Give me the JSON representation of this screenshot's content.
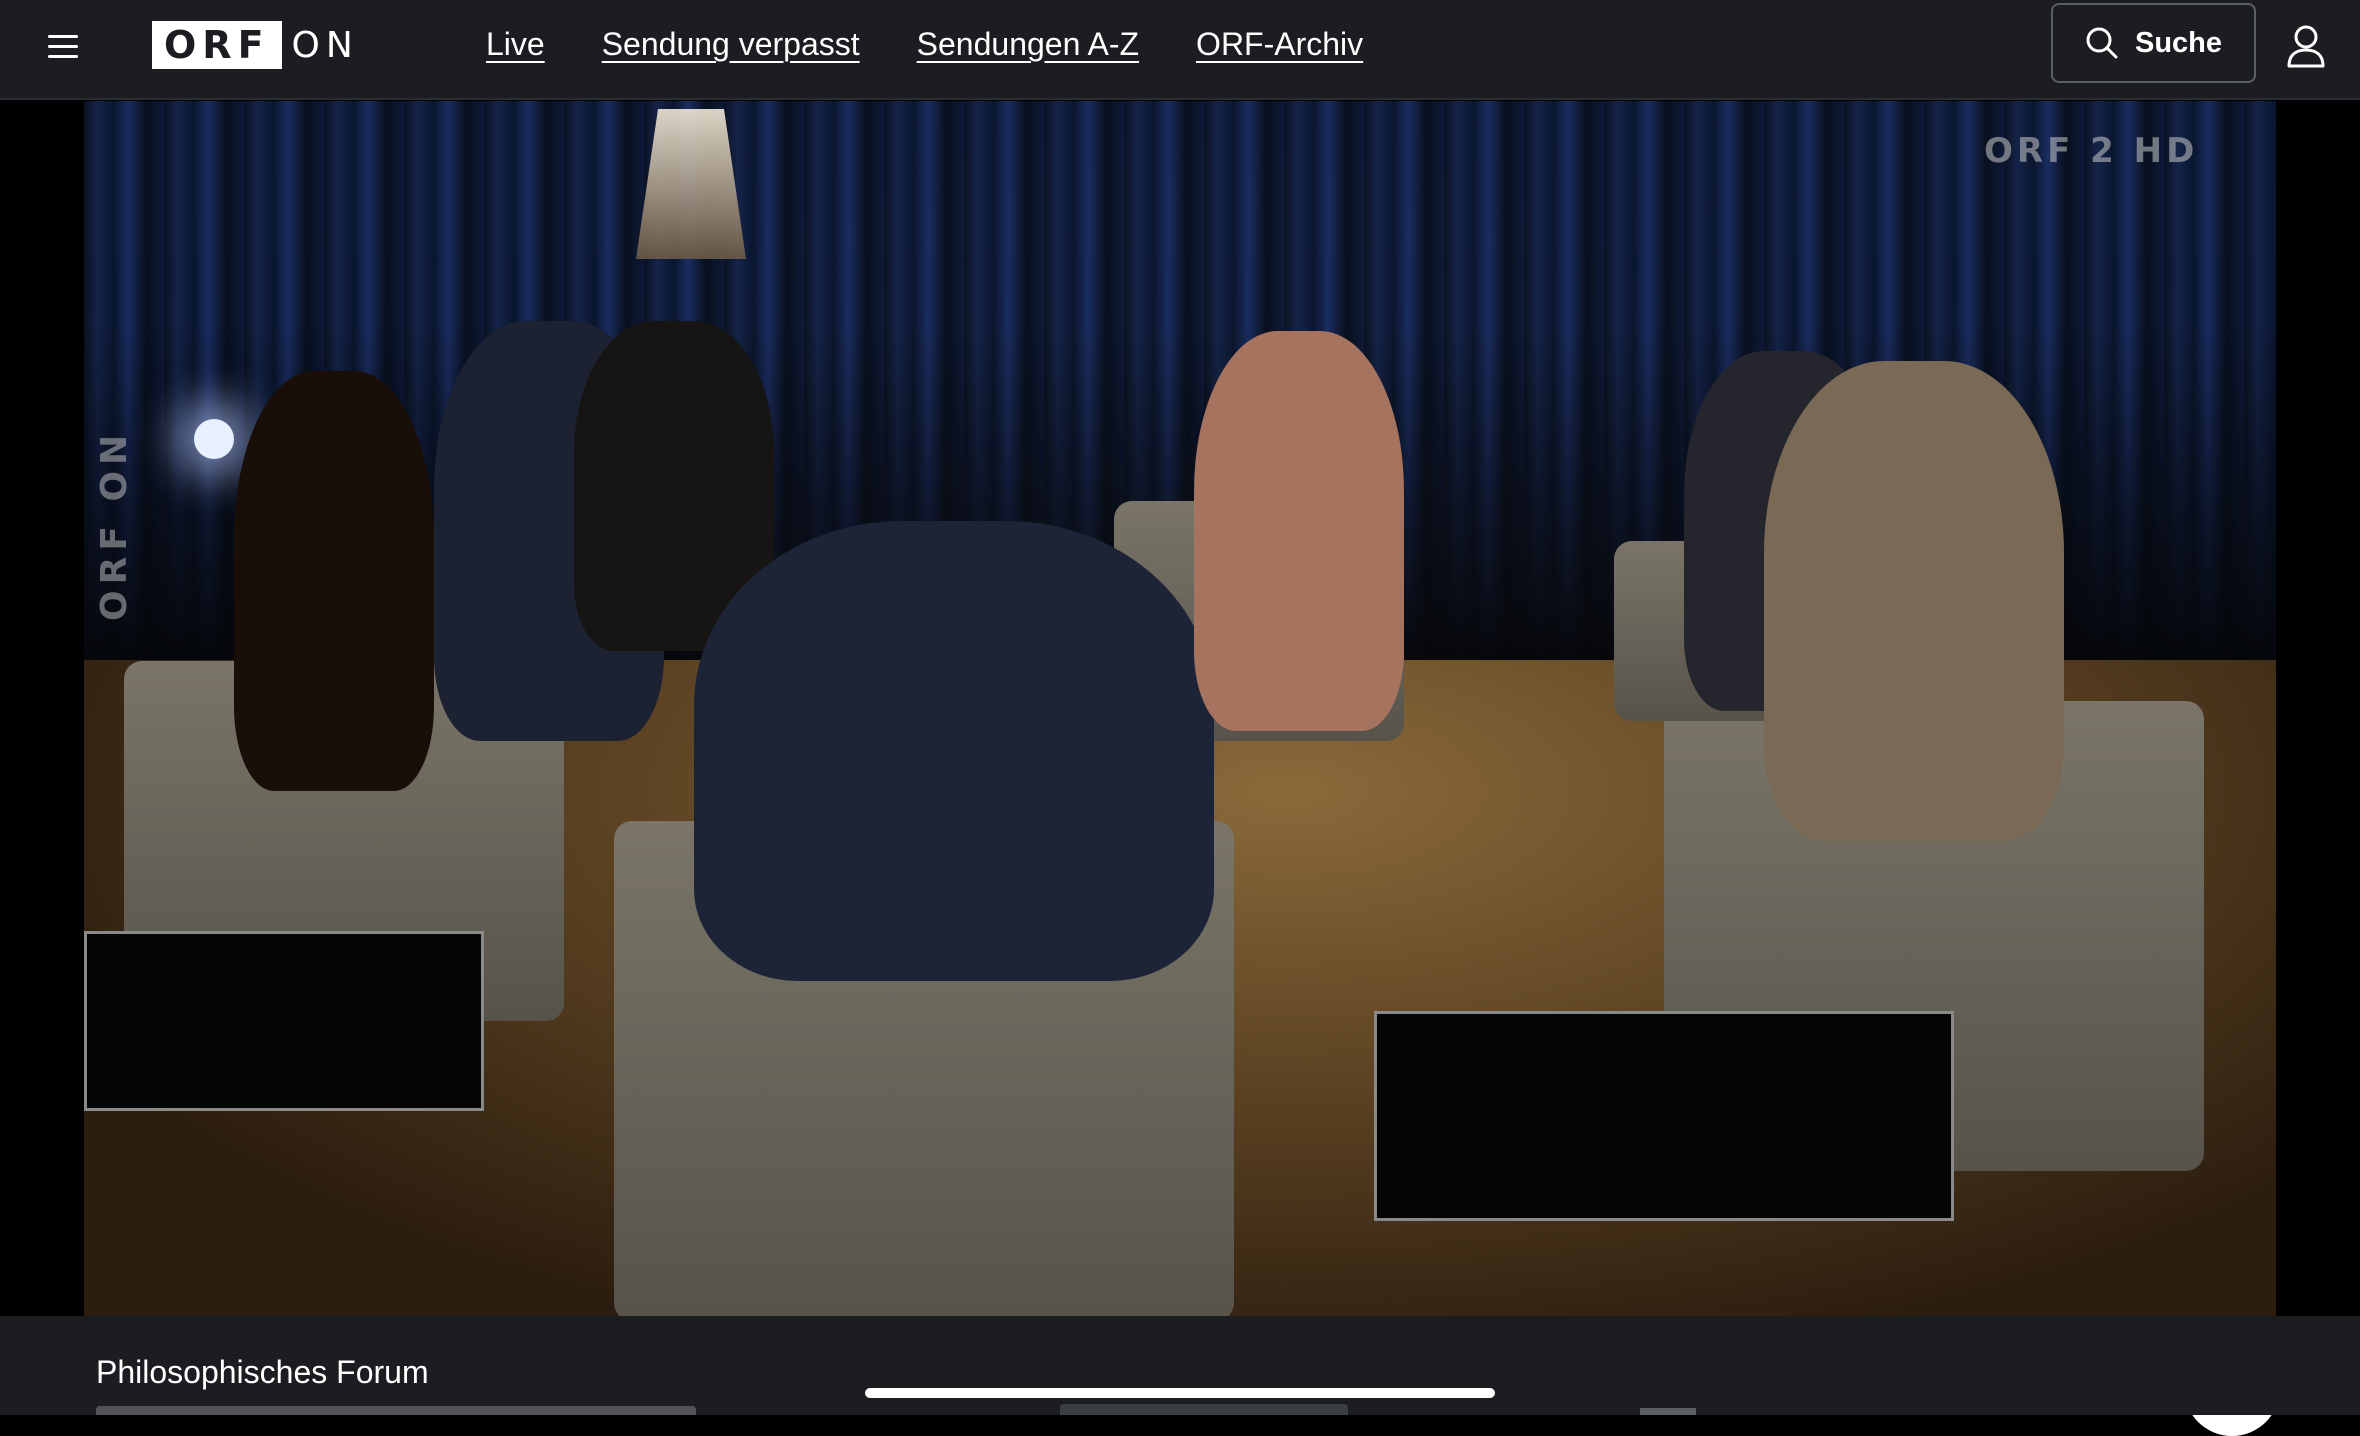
{
  "header": {
    "logo_box": "ORF",
    "logo_suffix": "ON",
    "nav": [
      "Live",
      "Sendung verpasst",
      "Sendungen A-Z",
      "ORF-Archiv"
    ],
    "search_label": "Suche",
    "icons": {
      "menu": "hamburger-icon",
      "search": "search-icon",
      "user": "user-icon"
    }
  },
  "player": {
    "channel_watermark": "ORF 2 HD",
    "side_watermark": "ORF ON",
    "help_icon": "question-circle-icon"
  },
  "show": {
    "title": "Philosophisches Forum"
  },
  "colors": {
    "header_bg": "#1b1d21",
    "text": "#ffffff",
    "search_border": "#5b5e65"
  }
}
